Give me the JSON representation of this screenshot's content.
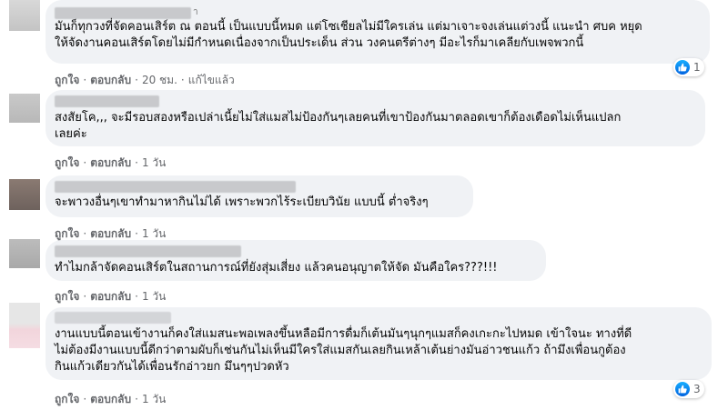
{
  "comments": [
    {
      "lines": [
        "มันก็ทุกวงที่จัดคอนเสิร์ต ณ ตอนนี้ เป็นแบบนี้หมด แต่โซเชียลไม่มีใครเล่น แต่มาเจาะจงเล่นแต่วงนี้ แนะนำ ศบค หยุด",
        "ให้จัดงานคอนเสิร์ตโดยไม่มีกำหนดเนื่องจากเป็นประเด็น ส่วน วงคนตรีต่างๆ มีอะไรก็มาเคลียกับเพจพวกนี้"
      ],
      "like": "ถูกใจ",
      "reply": "ตอบกลับ",
      "time": "20 ชม.",
      "edited": "แก้ไขแล้ว",
      "reactions": "1"
    },
    {
      "lines": [
        "สงสัยโค,,, จะมีรอบสองหรือเปล่าเนี้ยไม่ใส่แมสไม่ป้องกันๆเลยคนที่เขาป้องกันมาตลอดเขาก็ต้องเดือดไม่เห็นแปลก",
        "เลยค่ะ"
      ],
      "like": "ถูกใจ",
      "reply": "ตอบกลับ",
      "time": "1 วัน"
    },
    {
      "lines": [
        "จะพาวงอื่นๆเขาทำมาหากินไม่ได้ เพราะพวกไร้ระเบียบวินัย แบบนี้ ต่ำจริงๆ"
      ],
      "like": "ถูกใจ",
      "reply": "ตอบกลับ",
      "time": "1 วัน"
    },
    {
      "lines": [
        "ทำไมกล้าจัดคอนเสิร์ตในสถานการณ์ที่ยังสุ่มเสี่ยง แล้วคนอนุญาตให้จัด มันคือใคร???!!!"
      ],
      "like": "ถูกใจ",
      "reply": "ตอบกลับ",
      "time": "1 วัน"
    },
    {
      "lines": [
        "งานแบบนี้ตอนเข้างานก็คงใส่แมสนะพอเพลงขึ้นหลือมีการดื่มก็เต้นมันๆนุกๆแมสก็คงเกะกะไปหมด เข้าใจนะ ทางที่ดี",
        "ไม่ต้องมีงานแบบนี้ดีกว่าตามผับก็เช่นกันไม่เห็นมีใครใส่แมสกันเลยกินเหล้าเต้นย่างมันอ่าวชนแก้ว ถ้ามึงเพื่อนกูต้อง",
        "กินแก้วเดียวกันได้เพื่อนรักอ่าวยก มึนๆๆปวดหัว"
      ],
      "like": "ถูกใจ",
      "reply": "ตอบกลับ",
      "time": "1 วัน",
      "reactions": "3"
    }
  ],
  "colors": {
    "bubble": "#f0f2f5",
    "meta": "#65676b",
    "like_blue": "#1877f2"
  },
  "icons": [
    "like-icon"
  ]
}
